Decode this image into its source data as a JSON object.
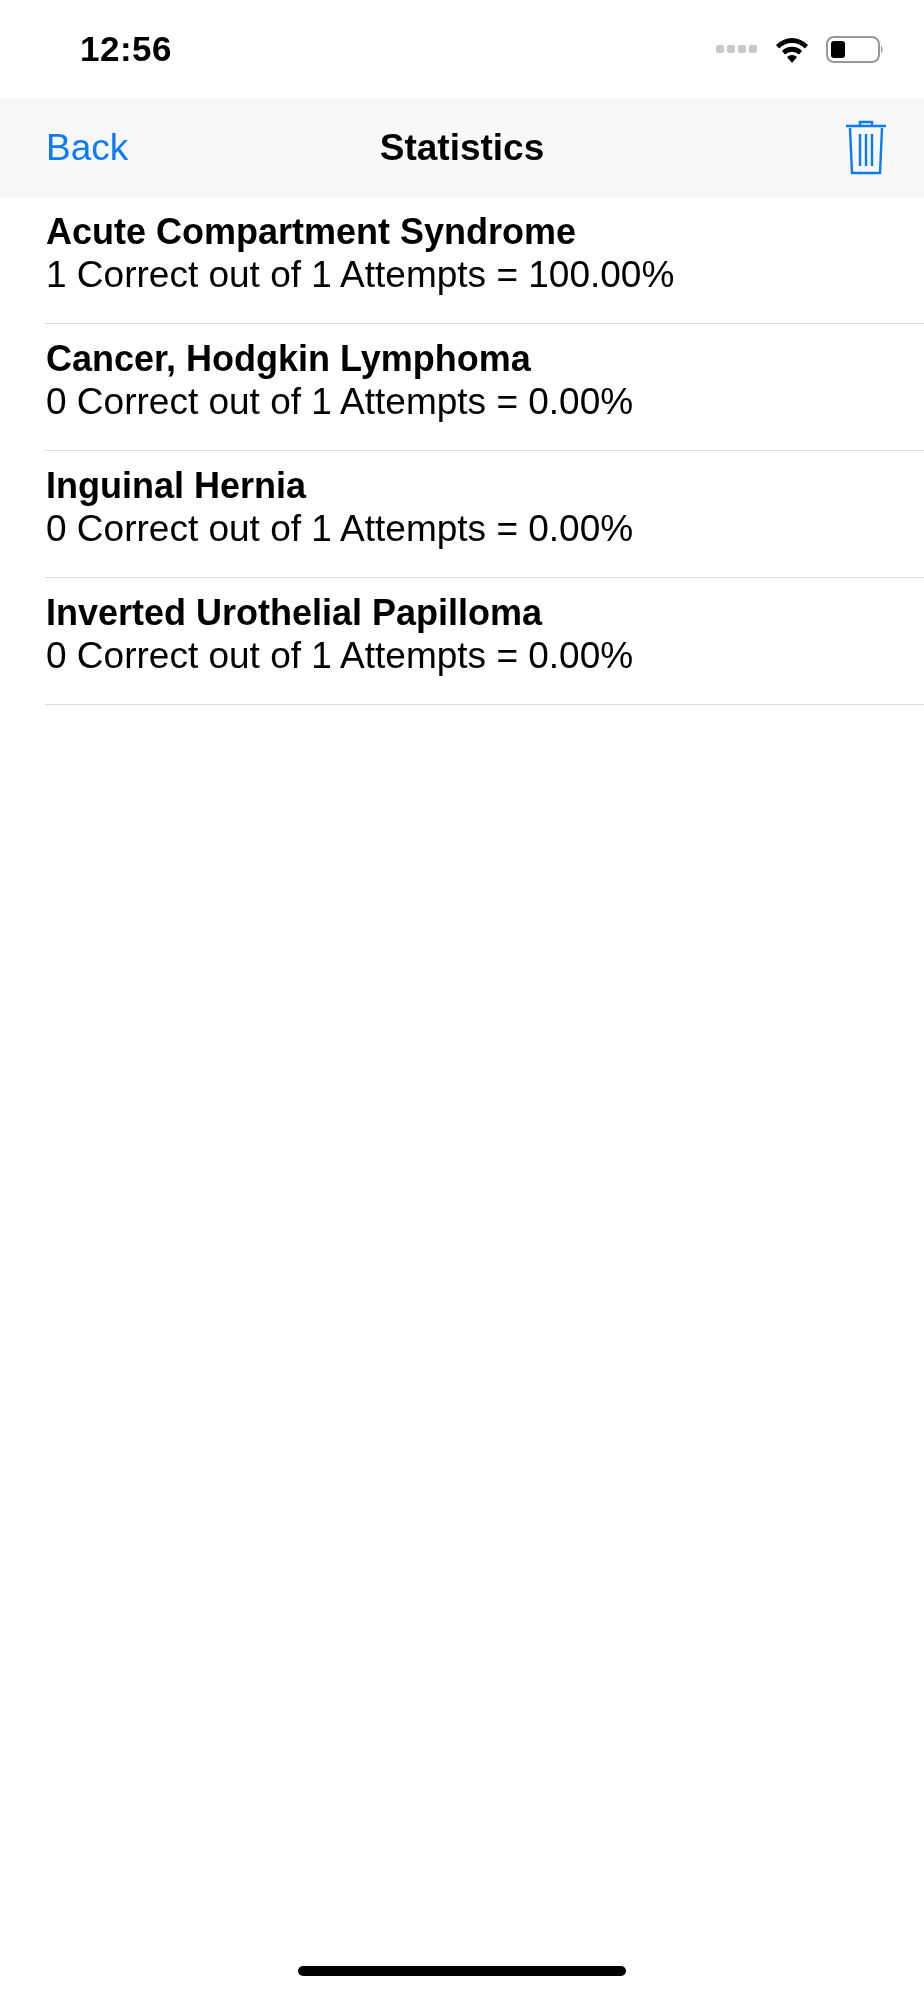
{
  "status_bar": {
    "time": "12:56"
  },
  "nav_bar": {
    "back": "Back",
    "title": "Statistics"
  },
  "rows": [
    {
      "title": "Acute Compartment Syndrome",
      "detail": "1 Correct out of 1 Attempts = 100.00%"
    },
    {
      "title": "Cancer, Hodgkin Lymphoma",
      "detail": "0 Correct out of 1 Attempts = 0.00%"
    },
    {
      "title": "Inguinal Hernia",
      "detail": "0 Correct out of 1 Attempts = 0.00%"
    },
    {
      "title": "Inverted Urothelial Papilloma",
      "detail": "0 Correct out of 1 Attempts = 0.00%"
    }
  ]
}
